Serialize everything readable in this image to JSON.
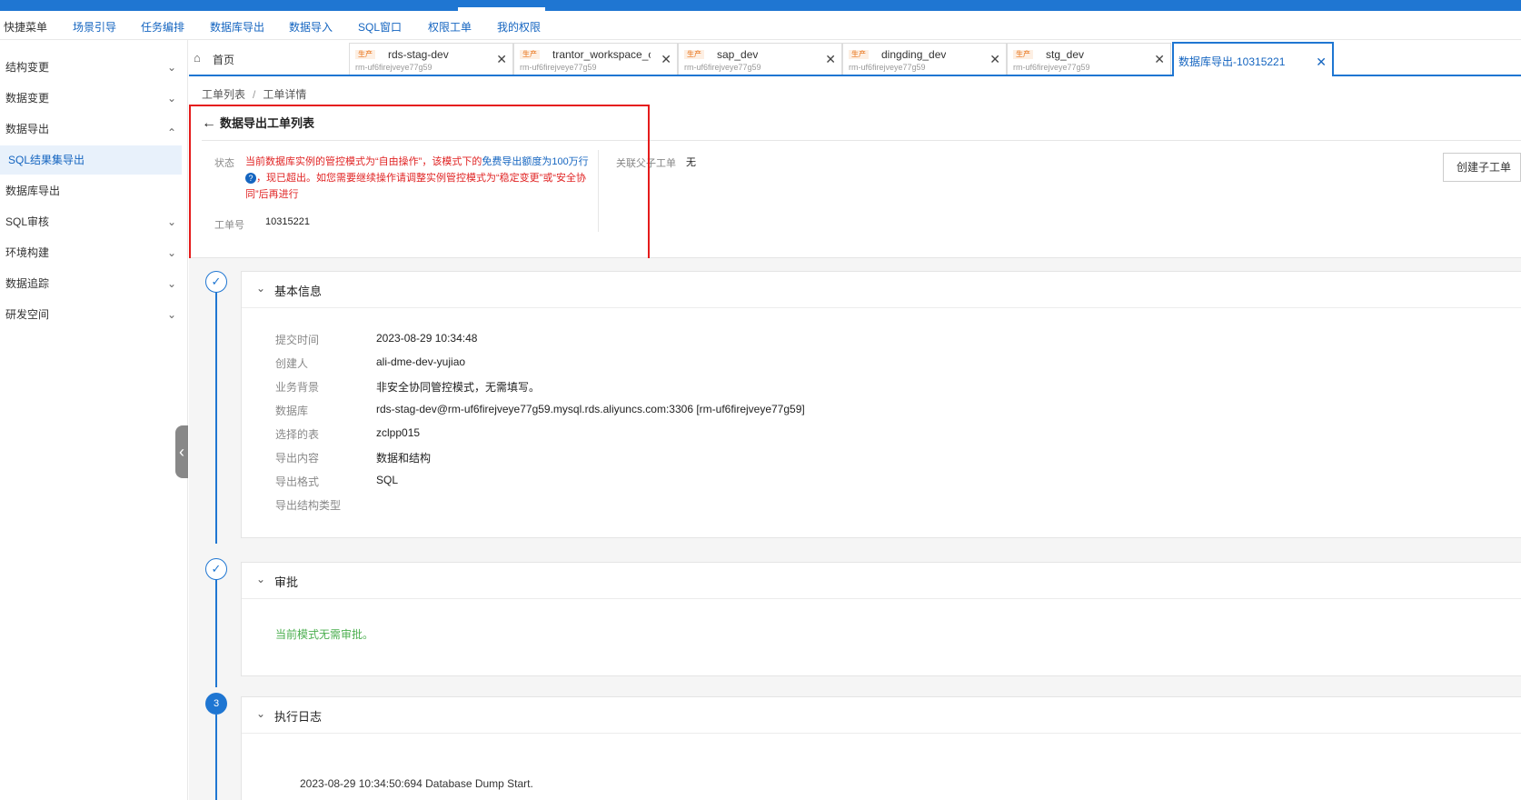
{
  "menubar": {
    "items": [
      "快捷菜单",
      "场景引导",
      "任务编排",
      "数据库导出",
      "数据导入",
      "SQL窗口",
      "权限工单",
      "我的权限"
    ]
  },
  "sidebar": {
    "items": [
      {
        "label": "结构变更",
        "chevron": "down"
      },
      {
        "label": "数据变更",
        "chevron": "down"
      },
      {
        "label": "数据导出",
        "chevron": "up"
      },
      {
        "label": "SQL结果集导出",
        "active": true
      },
      {
        "label": "数据库导出"
      },
      {
        "label": "SQL审核",
        "chevron": "down"
      },
      {
        "label": "环境构建",
        "chevron": "down"
      },
      {
        "label": "数据追踪",
        "chevron": "down"
      },
      {
        "label": "研发空间",
        "chevron": "down"
      }
    ]
  },
  "tabs": {
    "home": "首页",
    "env_badge": "生产",
    "items": [
      {
        "name": "rds-stag-dev",
        "sub": "rm-uf6firejveye77g59"
      },
      {
        "name": "trantor_workspace_c",
        "sub": "rm-uf6firejveye77g59"
      },
      {
        "name": "sap_dev",
        "sub": "rm-uf6firejveye77g59"
      },
      {
        "name": "dingding_dev",
        "sub": "rm-uf6firejveye77g59"
      },
      {
        "name": "stg_dev",
        "sub": "rm-uf6firejveye77g59"
      }
    ],
    "active": "数据库导出-10315221"
  },
  "breadcrumb": {
    "list": "工单列表",
    "sep": "/",
    "detail": "工单详情"
  },
  "header": {
    "title": "数据导出工单列表",
    "status_label": "状态",
    "status_part1": "当前数据库实例的管控模式为“自由操作”，该模式下的",
    "status_link": "免费导出额度为100万行",
    "status_part2": "，现已超出。如您需要继续操作请调整实例管控模式为“稳定变更”或“安全协同”后再进行",
    "order_label": "工单号",
    "order_value": "10315221",
    "related_label": "关联父子工单",
    "related_value": "无",
    "create_child": "创建子工单"
  },
  "basic": {
    "title": "基本信息",
    "rows": [
      {
        "k": "提交时间",
        "v": "2023-08-29 10:34:48"
      },
      {
        "k": "创建人",
        "v": "ali-dme-dev-yujiao"
      },
      {
        "k": "业务背景",
        "v": "非安全协同管控模式，无需填写。"
      },
      {
        "k": "数据库",
        "v": "rds-stag-dev@rm-uf6firejveye77g59.mysql.rds.aliyuncs.com:3306 [rm-uf6firejveye77g59]"
      },
      {
        "k": "选择的表",
        "v": "zclpp015"
      },
      {
        "k": "导出内容",
        "v": "数据和结构"
      },
      {
        "k": "导出格式",
        "v": "SQL"
      },
      {
        "k": "导出结构类型",
        "v": ""
      }
    ]
  },
  "approval": {
    "title": "审批",
    "text": "当前模式无需审批。"
  },
  "log": {
    "step": "3",
    "title": "执行日志",
    "line": "2023-08-29 10:34:50:694 Database Dump Start."
  },
  "colors": {
    "accent": "#1f76d2",
    "error": "#e02424",
    "success": "#4caf50",
    "highlight_box": "#e51b1b"
  }
}
